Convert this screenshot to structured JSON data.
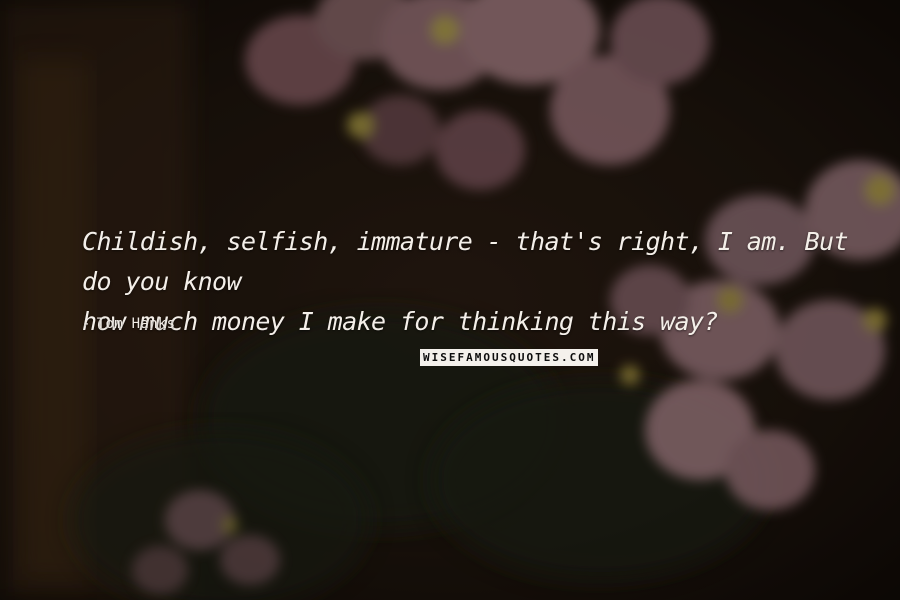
{
  "quote": {
    "line1": "Childish, selfish, immature - that's right, I am. But do you know",
    "line2": "how much money I make for thinking this way?"
  },
  "author": {
    "dash": "-",
    "name": "Tom Hanks"
  },
  "watermark": {
    "text": "WISEFAMOUSQUOTES.COM"
  },
  "background": {
    "subject": "pink-begonia-flowers",
    "tones": [
      "#1a120c",
      "#2b1e14",
      "#7a4e52",
      "#c28a95",
      "#e2d06a"
    ]
  }
}
